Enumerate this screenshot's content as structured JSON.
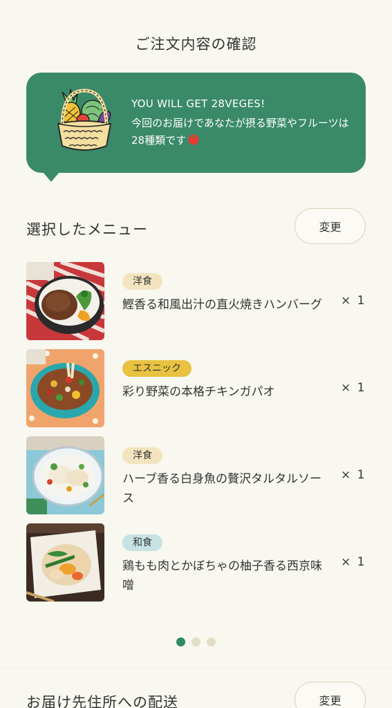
{
  "header": {
    "title": "ご注文内容の確認"
  },
  "banner": {
    "headline": "YOU WILL GET 28VEGES!",
    "message": "今回のお届けであなたが摂る野菜やフルーツは28種類です",
    "icon": "vegetable-basket-icon",
    "bg_color": "#3a8a69"
  },
  "menu_section": {
    "title": "選択したメニュー",
    "change_label": "変更",
    "items": [
      {
        "tag": "洋食",
        "tag_color": "#f3e4bf",
        "name": "鰹香る和風出汁の直火焼きハンバーグ",
        "qty": "× 1"
      },
      {
        "tag": "エスニック",
        "tag_color": "#e8c240",
        "name": "彩り野菜の本格チキンガパオ",
        "qty": "× 1"
      },
      {
        "tag": "洋食",
        "tag_color": "#f3e4bf",
        "name": "ハーブ香る白身魚の贅沢タルタルソース",
        "qty": "× 1"
      },
      {
        "tag": "和食",
        "tag_color": "#c6e2e3",
        "name": "鶏もも肉とかぼちゃの柚子香る西京味噌",
        "qty": "× 1"
      }
    ]
  },
  "pagination": {
    "active_index": 0,
    "count": 3,
    "active_color": "#2e8b63",
    "inactive_color": "#e2ddc6"
  },
  "delivery_section": {
    "title": "お届け先住所への配送",
    "change_label": "変更"
  }
}
